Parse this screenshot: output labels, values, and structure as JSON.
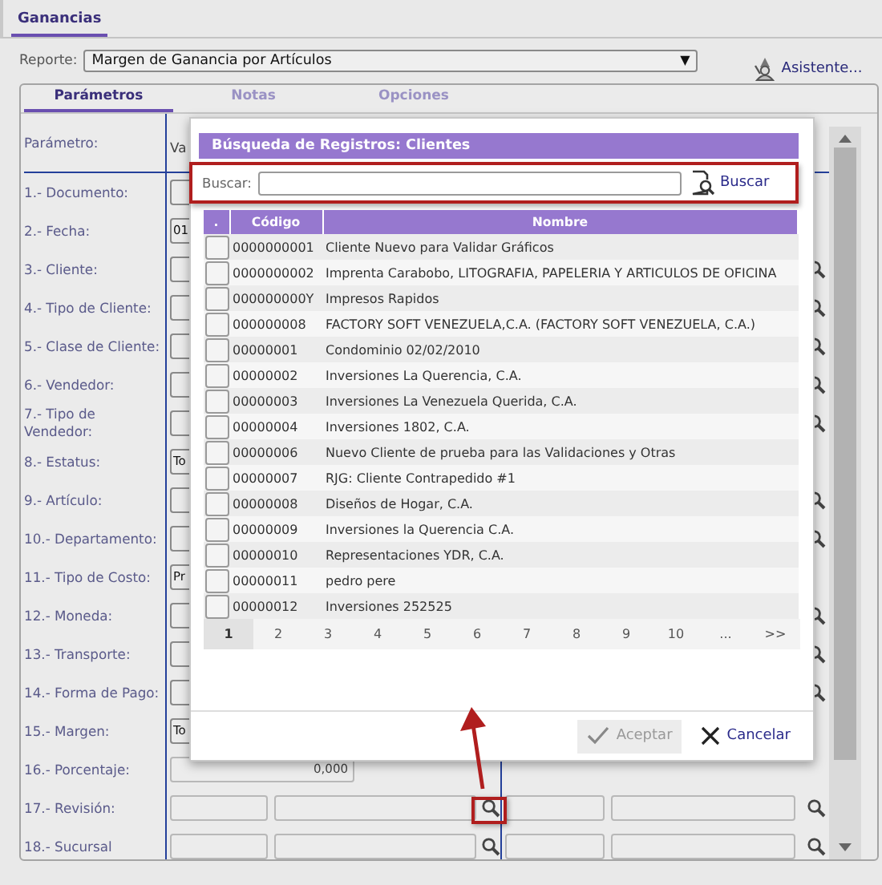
{
  "tabs": [
    {
      "label": "Ganancias",
      "selected": true
    }
  ],
  "report": {
    "label": "Reporte:",
    "value": "Margen de Ganancia por Artículos",
    "arrow": "▼"
  },
  "assistant": {
    "label": "Asistente..."
  },
  "panel_tabs": [
    {
      "label": "Parámetros",
      "selected": true
    },
    {
      "label": "Notas",
      "selected": false
    },
    {
      "label": "Opciones",
      "selected": false
    }
  ],
  "parameters": {
    "header": "Parámetro:",
    "value_header": "Va",
    "rows": [
      {
        "label": "1.- Documento:",
        "kind": "hidden",
        "lookup": false
      },
      {
        "label": "2.- Fecha:",
        "kind": "hidden",
        "value": "01",
        "lookup": false
      },
      {
        "label": "3.- Cliente:",
        "kind": "hidden",
        "lookup": true
      },
      {
        "label": "4.- Tipo de Cliente:",
        "kind": "hidden",
        "lookup": true
      },
      {
        "label": "5.- Clase de Cliente:",
        "kind": "hidden",
        "lookup": true
      },
      {
        "label": "6.- Vendedor:",
        "kind": "hidden",
        "lookup": true
      },
      {
        "label": "7.- Tipo de Vendedor:",
        "kind": "hidden",
        "lookup": true
      },
      {
        "label": "8.- Estatus:",
        "kind": "hidden",
        "value": "To",
        "lookup": false
      },
      {
        "label": "9.- Artículo:",
        "kind": "hidden",
        "lookup": true
      },
      {
        "label": "10.- Departamento:",
        "kind": "hidden",
        "lookup": true
      },
      {
        "label": "11.- Tipo de Costo:",
        "kind": "hidden",
        "value": "Pr",
        "lookup": false
      },
      {
        "label": "12.- Moneda:",
        "kind": "hidden",
        "lookup": true
      },
      {
        "label": "13.- Transporte:",
        "kind": "hidden",
        "lookup": true
      },
      {
        "label": "14.- Forma de Pago:",
        "kind": "hidden",
        "lookup": true
      },
      {
        "label": "15.- Margen:",
        "kind": "hidden",
        "value": "To",
        "lookup": false
      },
      {
        "label": "16.- Porcentaje:",
        "kind": "number",
        "value": "0,000"
      },
      {
        "label": "17.- Revisión:",
        "kind": "range"
      },
      {
        "label": "18.- Sucursal",
        "kind": "range"
      }
    ]
  },
  "search_dialog": {
    "title": "Búsqueda de Registros: Clientes",
    "search_label": "Buscar:",
    "search_button": "Buscar",
    "columns": [
      ".",
      "Código",
      "Nombre"
    ],
    "rows": [
      {
        "code": "0000000001",
        "name": "Cliente Nuevo para Validar Gráficos",
        "checked": false
      },
      {
        "code": "0000000002",
        "name": "Imprenta Carabobo, LITOGRAFIA, PAPELERIA Y ARTICULOS DE OFICINA",
        "checked": false
      },
      {
        "code": "000000000Y",
        "name": "Impresos Rapidos",
        "checked": false
      },
      {
        "code": "000000008",
        "name": "FACTORY SOFT VENEZUELA,C.A. (FACTORY SOFT VENEZUELA, C.A.)",
        "checked": false
      },
      {
        "code": "00000001",
        "name": "Condominio 02/02/2010",
        "checked": false
      },
      {
        "code": "00000002",
        "name": "Inversiones La Querencia, C.A.",
        "checked": false
      },
      {
        "code": "00000003",
        "name": "Inversiones La Venezuela Querida, C.A.",
        "checked": false
      },
      {
        "code": "00000004",
        "name": "Inversiones 1802, C.A.",
        "checked": false
      },
      {
        "code": "00000006",
        "name": "Nuevo Cliente de prueba para las Validaciones y Otras",
        "checked": false
      },
      {
        "code": "00000007",
        "name": "RJG: Cliente Contrapedido #1",
        "checked": false
      },
      {
        "code": "00000008",
        "name": "Diseños de Hogar, C.A.",
        "checked": false
      },
      {
        "code": "00000009",
        "name": "Inversiones la Querencia C.A.",
        "checked": false
      },
      {
        "code": "00000010",
        "name": "Representaciones YDR, C.A.",
        "checked": false
      },
      {
        "code": "00000011",
        "name": "pedro pere",
        "checked": false
      },
      {
        "code": "00000012",
        "name": "Inversiones 252525",
        "checked": false
      }
    ],
    "pages": [
      {
        "label": "1",
        "selected": true
      },
      {
        "label": "2",
        "selected": false
      },
      {
        "label": "3",
        "selected": false
      },
      {
        "label": "4",
        "selected": false
      },
      {
        "label": "5",
        "selected": false
      },
      {
        "label": "6",
        "selected": false
      },
      {
        "label": "7",
        "selected": false
      },
      {
        "label": "8",
        "selected": false
      },
      {
        "label": "9",
        "selected": false
      },
      {
        "label": "10",
        "selected": false
      },
      {
        "label": "...",
        "selected": false
      },
      {
        "label": ">>",
        "selected": false
      }
    ],
    "accept": {
      "label": "Aceptar",
      "disabled": true
    },
    "cancel": {
      "label": "Cancelar"
    }
  }
}
